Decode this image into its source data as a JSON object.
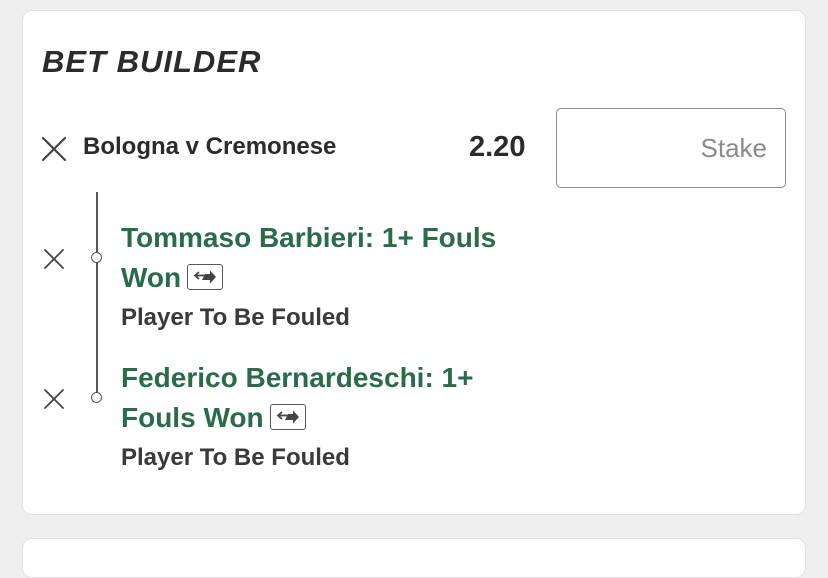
{
  "title": "BET BUILDER",
  "bet": {
    "match": "Bologna v Cremonese",
    "odds": "2.20",
    "stake_placeholder": "Stake"
  },
  "legs": [
    {
      "selection_line1": "Tommaso Barbieri: 1+ Fouls",
      "selection_line2": "Won",
      "market": "Player To Be Fouled"
    },
    {
      "selection_line1": "Federico Bernardeschi: 1+",
      "selection_line2": "Fouls Won",
      "market": "Player To Be Fouled"
    }
  ],
  "colors": {
    "selection_green": "#2a6b4a",
    "text_dark": "#2b2b2b",
    "background": "#efefef"
  },
  "icons": {
    "remove": "close-icon",
    "swap": "swap-icon"
  }
}
